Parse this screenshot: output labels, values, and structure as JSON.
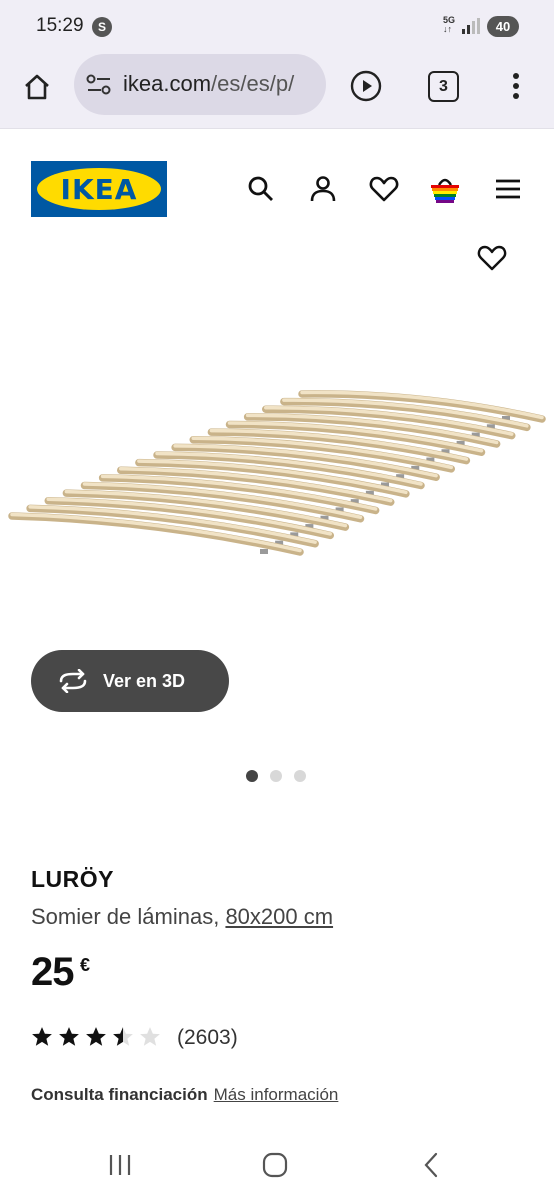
{
  "status": {
    "time": "15:29",
    "notification_badge": "S",
    "network": "5G",
    "battery": "40"
  },
  "browser": {
    "url_domain": "ikea.com",
    "url_path": "/es/es/p/",
    "tab_count": "3"
  },
  "header": {
    "logo_text": "IKEA",
    "icons": [
      "search-icon",
      "account-icon",
      "favorites-icon",
      "cart-icon",
      "menu-icon"
    ]
  },
  "gallery": {
    "view_3d_label": "Ver en 3D",
    "slide_count": 3,
    "active_slide": 1
  },
  "product": {
    "name": "LURÖY",
    "description": "Somier de láminas,",
    "size": "80x200 cm",
    "price": "25",
    "currency": "€",
    "rating": 3.5,
    "rating_max": 5,
    "review_count": "(2603)",
    "financing_label": "Consulta financiación",
    "financing_link": "Más información"
  },
  "colors": {
    "ikea_blue": "#0058a3",
    "ikea_yellow": "#ffdb00",
    "button_dark": "#484848"
  }
}
